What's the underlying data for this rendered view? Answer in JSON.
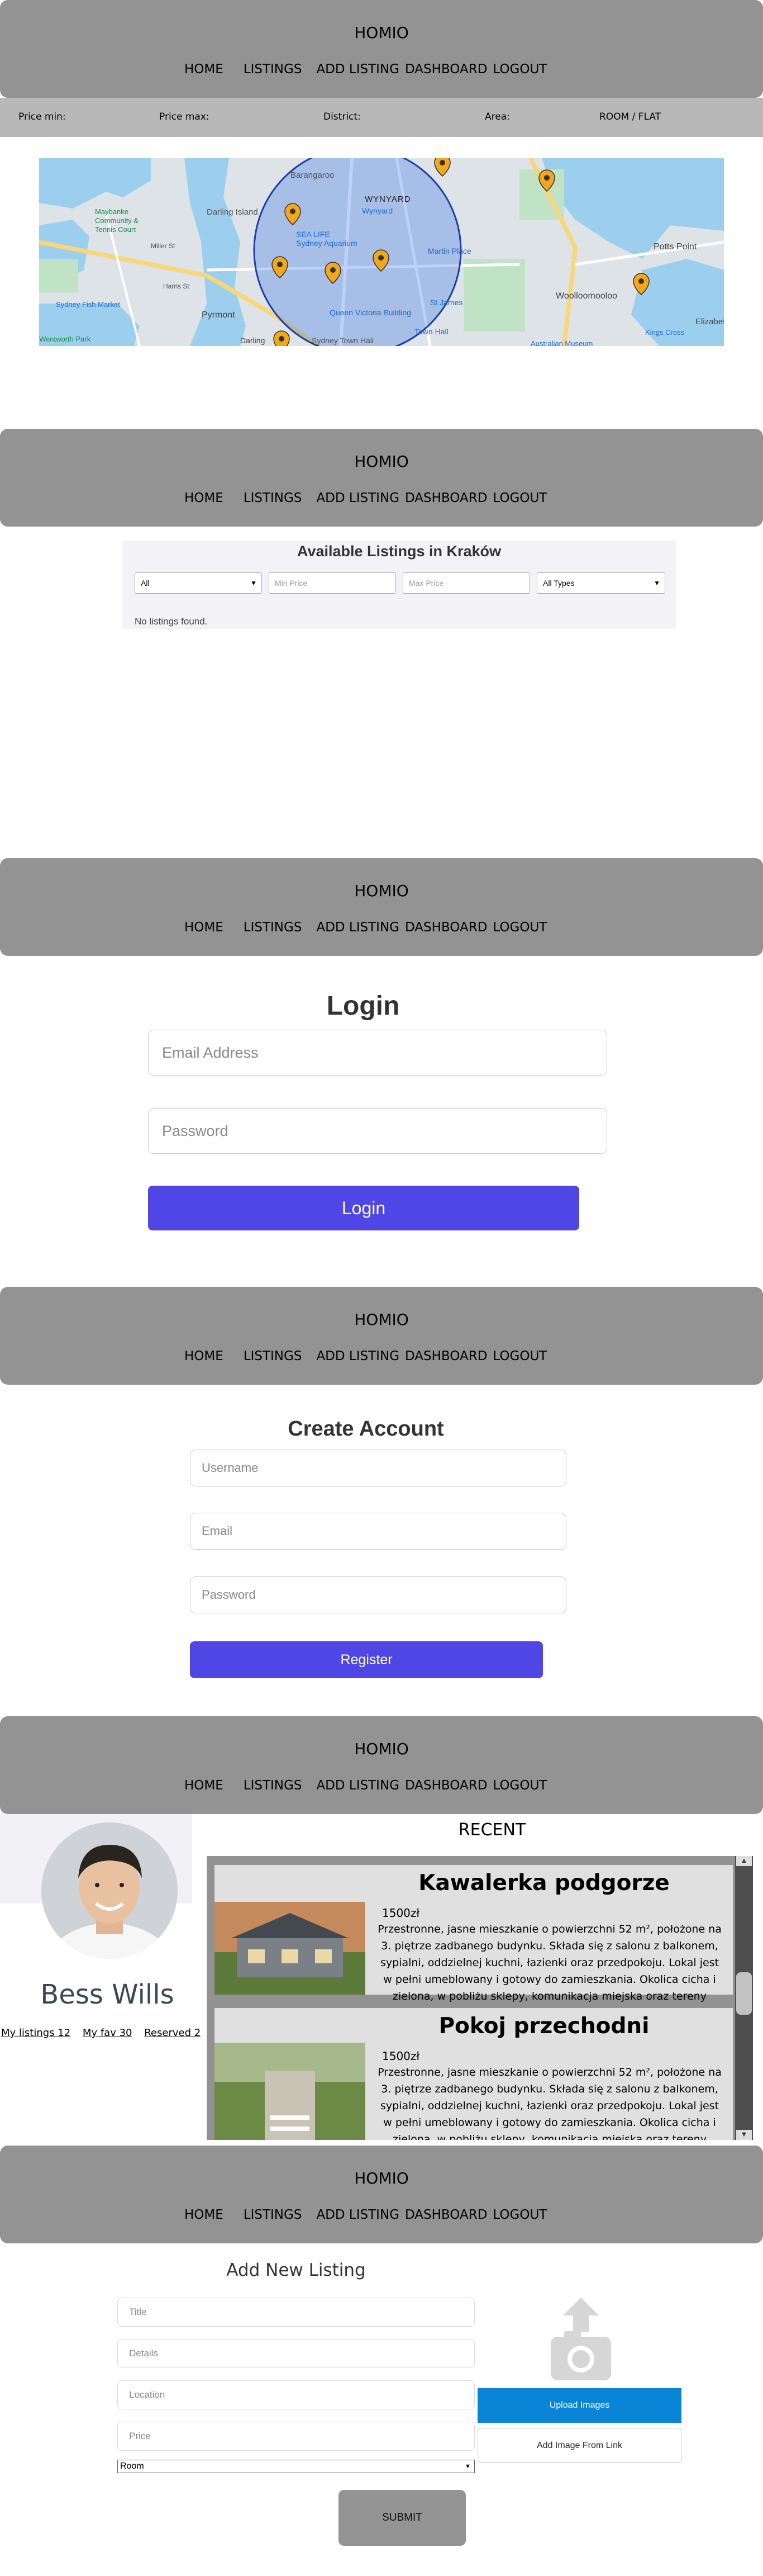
{
  "nav": {
    "brand": "HOMIO",
    "items": [
      "HOME",
      "LISTINGS",
      "ADD LISTING",
      "DASHBOARD",
      "LOGOUT"
    ]
  },
  "map_view": {
    "filters": [
      "Price min:",
      "Price max:",
      "District:",
      "Area:",
      "ROOM / FLAT"
    ],
    "map_labels": [
      "Barangaroo",
      "WYNYARD",
      "Wynyard",
      "Darling Island",
      "Maybanke Community & Tennis Court",
      "Pyrmont",
      "SEA LIFE Sydney Aquarium",
      "Martin Place",
      "Queen Victoria Building",
      "Sydney Town Hall",
      "Town Hall",
      "St James",
      "Darling",
      "Australian Museum",
      "Woolloomooloo",
      "Potts Point",
      "Kings Cross",
      "Sydney Fish Market",
      "Elizabeth",
      "Wentworth Park",
      "Harris St",
      "Miller St"
    ]
  },
  "listings_view": {
    "title": "Available Listings in Kraków",
    "district_select": "All",
    "min_price_placeholder": "Min Price",
    "max_price_placeholder": "Max Price",
    "type_select": "All Types",
    "empty_message": "No listings found."
  },
  "login_view": {
    "title": "Login",
    "email_placeholder": "Email Address",
    "password_placeholder": "Password",
    "button": "Login"
  },
  "register_view": {
    "title": "Create Account",
    "username_placeholder": "Username",
    "email_placeholder": "Email",
    "password_placeholder": "Password",
    "button": "Register"
  },
  "dashboard_view": {
    "user_name": "Bess Wills",
    "links": [
      "My listings 12",
      "My fav 30",
      "Reserved 2"
    ],
    "recent_title": "RECENT",
    "cards": [
      {
        "title": "Kawalerka podgorze",
        "price": "1500zł",
        "description": "Przestronne, jasne mieszkanie o powierzchni 52 m², położone na 3. piętrze zadbanego budynku. Składa się z salonu z balkonem, sypialni, oddzielnej kuchni, łazienki oraz przedpokoju. Lokal jest w pełni umeblowany i gotowy do zamieszkania. Okolica cicha i zielona, w pobliżu sklepy, komunikacja miejska oraz tereny rekreacyjne."
      },
      {
        "title": "Pokoj przechodni",
        "price": "1500zł",
        "description": "Przestronne, jasne mieszkanie o powierzchni 52 m², położone na 3. piętrze zadbanego budynku. Składa się z salonu z balkonem, sypialni, oddzielnej kuchni, łazienki oraz przedpokoju. Lokal jest w pełni umeblowany i gotowy do zamieszkania. Okolica cicha i zielona, w pobliżu sklepy, komunikacja miejska oraz tereny rekreacyjne."
      }
    ]
  },
  "add_listing_view": {
    "title": "Add New Listing",
    "title_placeholder": "Title",
    "details_placeholder": "Details",
    "location_placeholder": "Location",
    "price_placeholder": "Price",
    "type_select": "Room",
    "upload_button": "Upload Images",
    "link_button": "Add Image From Link",
    "submit_button": "SUBMIT"
  },
  "colors": {
    "header_bg": "#939393",
    "accent": "#4f46e5",
    "upload_blue": "#0a84d6",
    "submit_grey": "#939393",
    "marker": "#f3a81b"
  }
}
